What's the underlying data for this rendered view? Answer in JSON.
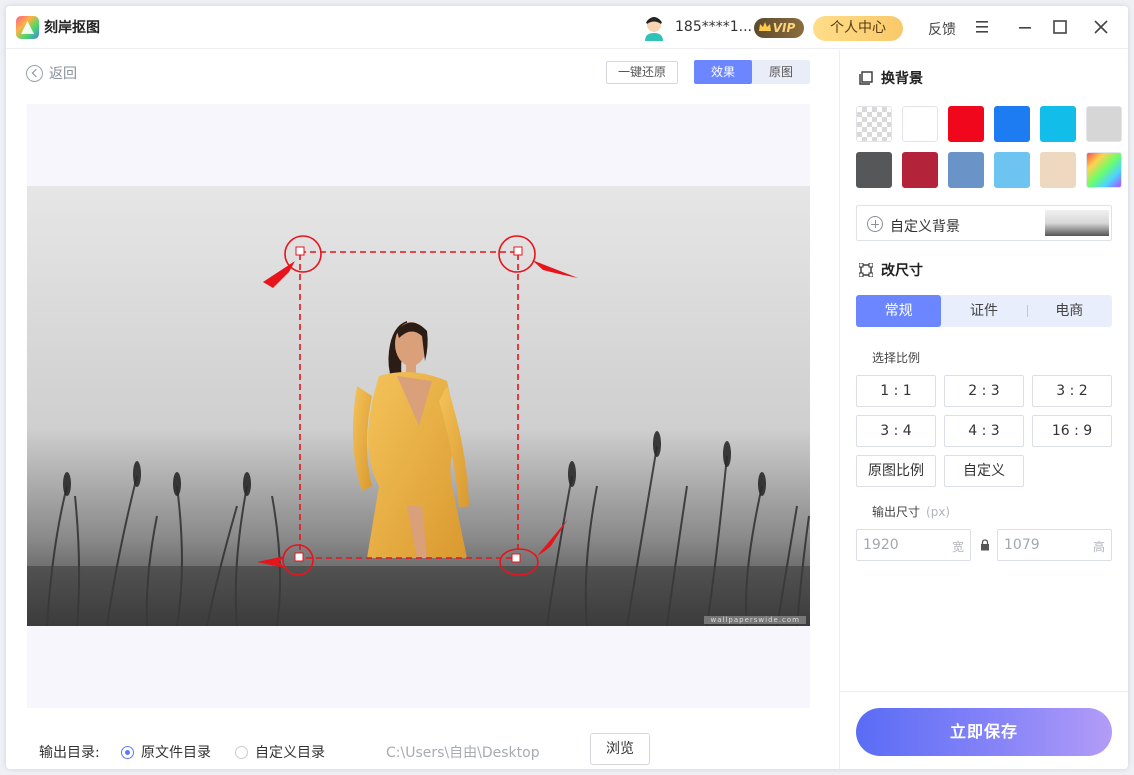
{
  "app": {
    "title": "刻岸抠图"
  },
  "header": {
    "username": "185****1...",
    "vip_label": "VIP",
    "user_center": "个人中心",
    "feedback": "反馈"
  },
  "toolbar": {
    "back_label": "返回",
    "restore_label": "一键还原",
    "view_effect": "效果",
    "view_original": "原图"
  },
  "canvas": {
    "watermark": "wallpaperswide.com"
  },
  "output": {
    "label": "输出目录:",
    "option_original": "原文件目录",
    "option_custom": "自定义目录",
    "path": "C:\\Users\\自由\\Desktop",
    "browse_label": "浏览",
    "selected": "原文件目录"
  },
  "background": {
    "title": "换背景",
    "swatches": [
      {
        "name": "transparent",
        "color": "checker"
      },
      {
        "name": "white",
        "color": "#ffffff"
      },
      {
        "name": "red",
        "color": "#f0071c"
      },
      {
        "name": "blue",
        "color": "#1e7cf2"
      },
      {
        "name": "cyan",
        "color": "#12bde9"
      },
      {
        "name": "light-gray",
        "color": "#d6d6d6"
      },
      {
        "name": "dark-gray",
        "color": "#555759"
      },
      {
        "name": "crimson",
        "color": "#b3243b"
      },
      {
        "name": "steel-blue",
        "color": "#6a93c8"
      },
      {
        "name": "sky-blue",
        "color": "#6dc4f0"
      },
      {
        "name": "beige",
        "color": "#eed9c0"
      },
      {
        "name": "rainbow",
        "color": "gradient"
      }
    ],
    "custom_label": "自定义背景"
  },
  "resize": {
    "title": "改尺寸",
    "tabs": [
      "常规",
      "证件",
      "电商"
    ],
    "active_tab": "常规",
    "ratio_label": "选择比例",
    "ratios": [
      "1 : 1",
      "2 : 3",
      "3 : 2",
      "3 : 4",
      "4 : 3",
      "16 : 9",
      "原图比例",
      "自定义"
    ],
    "output_size_label": "输出尺寸",
    "unit": "(px)",
    "width": "1920",
    "width_unit": "宽",
    "height": "1079",
    "height_unit": "高"
  },
  "save_label": "立即保存",
  "colors": {
    "accent": "#6b86ff",
    "annotation": "#e8141c"
  }
}
